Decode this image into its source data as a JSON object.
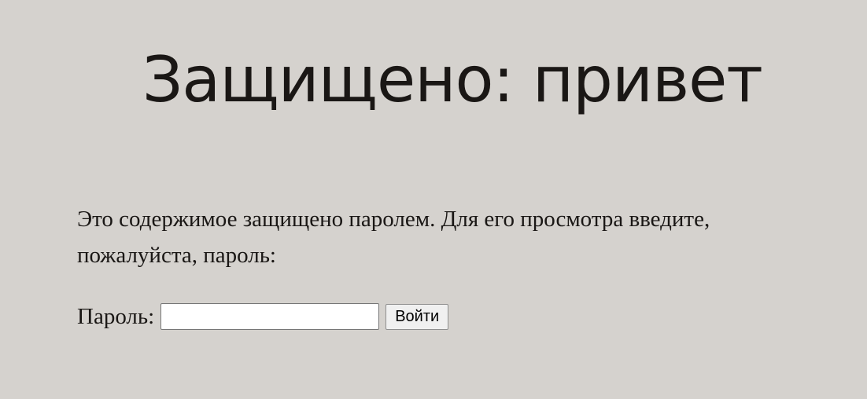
{
  "header": {
    "title": "Защищено: привет"
  },
  "main": {
    "intro_text": "Это содержимое защищено паролем. Для его просмотра введите, пожалуйста, пароль:",
    "password_form": {
      "label": "Пароль:",
      "input_value": "",
      "submit_label": "Войти"
    }
  }
}
